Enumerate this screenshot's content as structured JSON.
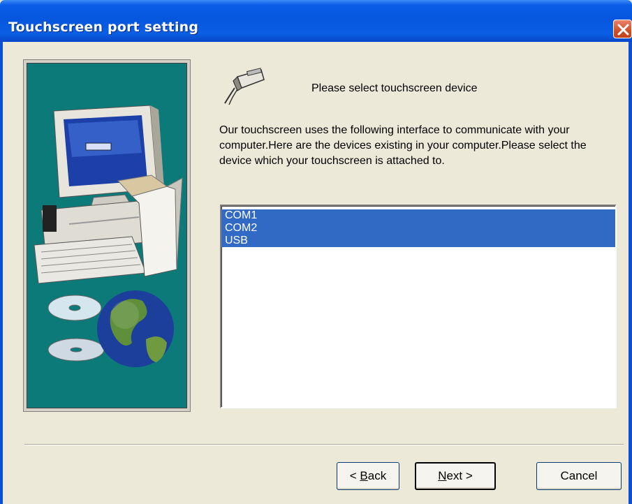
{
  "window": {
    "title": "Touchscreen port setting"
  },
  "main": {
    "heading": "Please select touchscreen device",
    "description": "Our touchscreen uses the following interface to communicate with your computer.Here are the devices existing in your computer.Please select the device which your touchscreen is attached to.",
    "devices": [
      "COM1",
      "COM2",
      "USB"
    ]
  },
  "buttons": {
    "back_prefix": "< ",
    "back_key": "B",
    "back_rest": "ack",
    "next_key": "N",
    "next_rest": "ext >",
    "cancel": "Cancel"
  },
  "icons": {
    "close": "close-icon",
    "plug": "plug-icon",
    "illustration": "computer-globe-illustration"
  },
  "colors": {
    "titlebar": "#0656de",
    "panel": "#ece9d8",
    "illustration_bg": "#0b7a78",
    "selection": "#316ac5"
  }
}
